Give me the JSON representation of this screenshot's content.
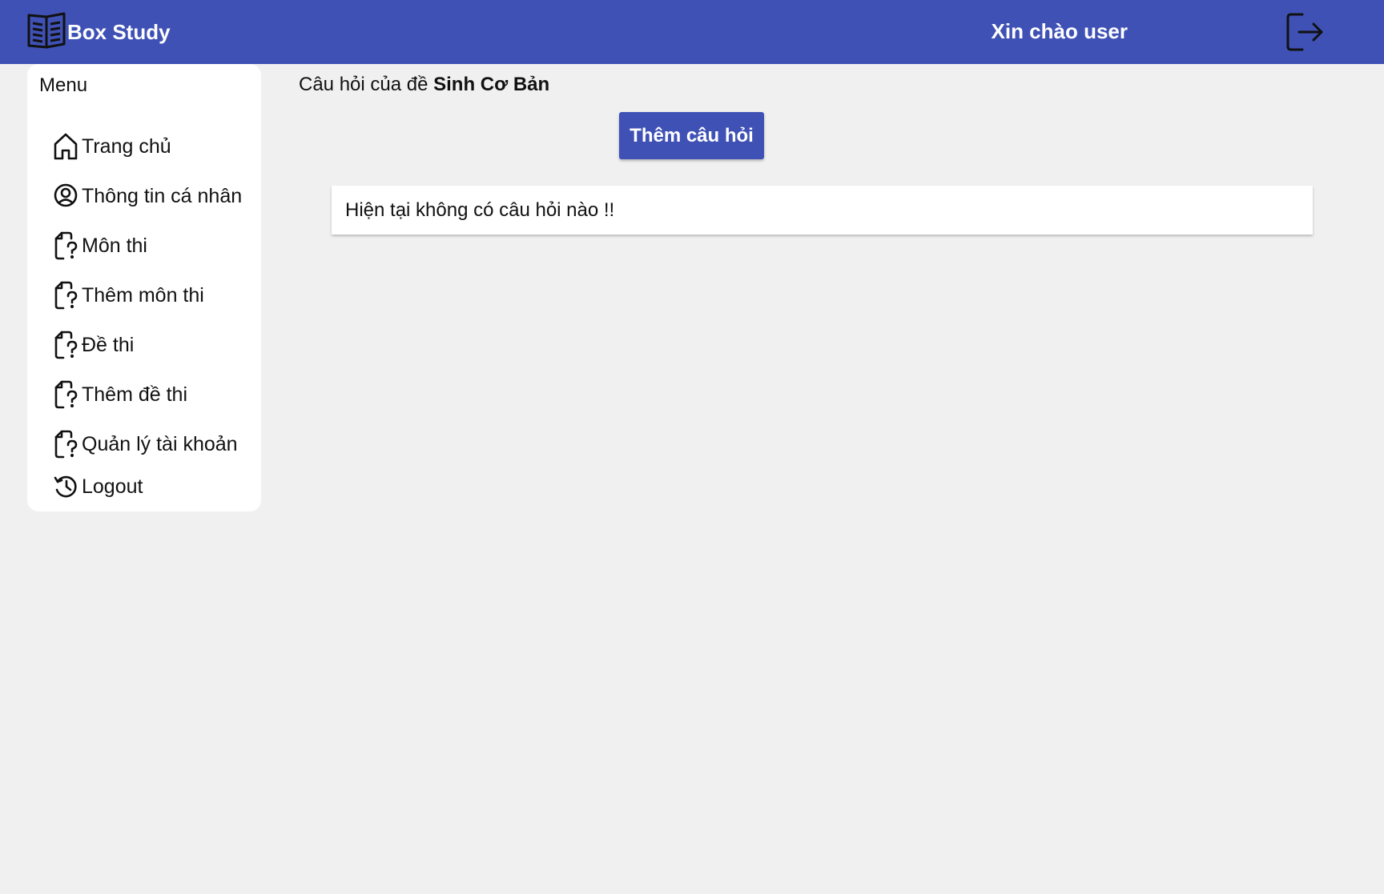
{
  "header": {
    "brand_title": "Box Study",
    "greeting": "Xin chào user",
    "brand_icon": "book-icon",
    "logout_icon": "logout-arrow-icon",
    "background_color": "#3f51b5"
  },
  "sidebar": {
    "title": "Menu",
    "items": [
      {
        "label": "Trang chủ",
        "icon": "home-icon"
      },
      {
        "label": "Thông tin cá nhân",
        "icon": "user-circle-icon"
      },
      {
        "label": "Môn thi",
        "icon": "file-question-icon"
      },
      {
        "label": "Thêm môn thi",
        "icon": "file-question-icon"
      },
      {
        "label": "Đề thi",
        "icon": "file-question-icon"
      },
      {
        "label": "Thêm đề thi",
        "icon": "file-question-icon"
      },
      {
        "label": "Quản lý tài khoản",
        "icon": "file-question-icon"
      },
      {
        "label": "Logout",
        "icon": "history-icon"
      }
    ]
  },
  "main": {
    "title_prefix": "Câu hỏi của đề",
    "exam_name": "Sinh Cơ Bản",
    "add_button_label": "Thêm câu hỏi",
    "empty_message": "Hiện tại không có câu hỏi nào !!"
  }
}
